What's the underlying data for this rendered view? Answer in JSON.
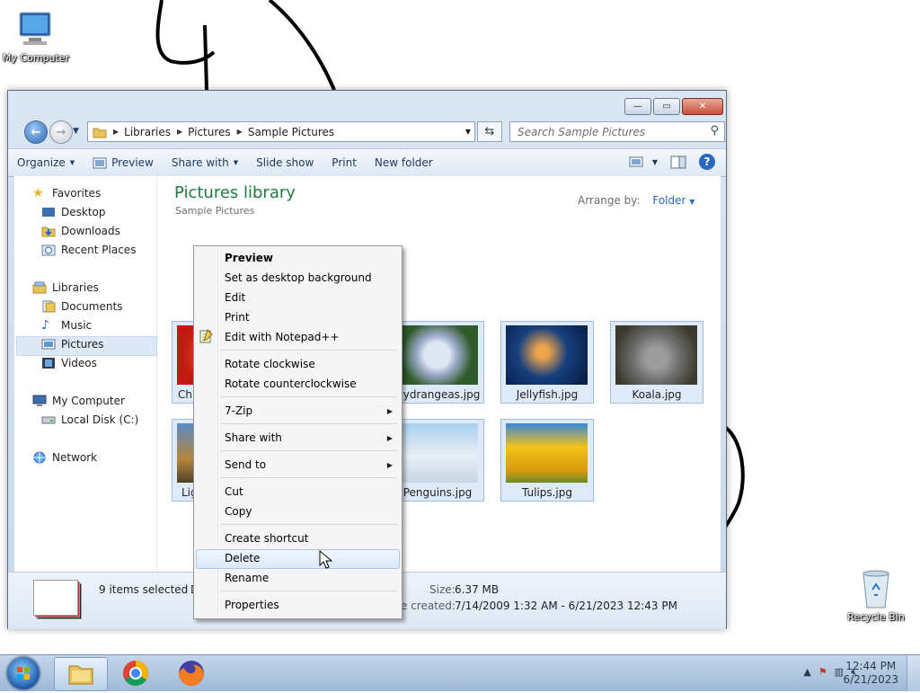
{
  "desktop": {
    "icons": [
      {
        "label": "My Computer",
        "icon": "my-computer-icon"
      },
      {
        "label": "Recycle Bin",
        "icon": "recycle-bin-icon"
      }
    ]
  },
  "window": {
    "address": {
      "segments": [
        "Libraries",
        "Pictures",
        "Sample Pictures"
      ]
    },
    "search_placeholder": "Search Sample Pictures",
    "toolbar": {
      "organize": "Organize",
      "preview": "Preview",
      "share_with": "Share with",
      "slide_show": "Slide show",
      "print": "Print",
      "new_folder": "New folder"
    },
    "nav_pane": {
      "favorites": "Favorites",
      "desktop": "Desktop",
      "downloads": "Downloads",
      "recent_places": "Recent Places",
      "libraries": "Libraries",
      "documents": "Documents",
      "music": "Music",
      "pictures": "Pictures",
      "videos": "Videos",
      "my_computer": "My Computer",
      "local_disk": "Local Disk (C:)",
      "network": "Network"
    },
    "library": {
      "title": "Pictures library",
      "subtitle": "Sample Pictures",
      "arrange_label": "Arrange by:",
      "arrange_value": "Folder"
    },
    "thumbnails": [
      {
        "caption": "Chr"
      },
      {
        "caption": ""
      },
      {
        "caption": "Hydrangeas.jpg"
      },
      {
        "caption": "Jellyfish.jpg"
      },
      {
        "caption": "Koala.jpg"
      },
      {
        "caption": "Lig"
      },
      {
        "caption": "Penguins.jpg"
      },
      {
        "caption": "Tulips.jpg"
      }
    ],
    "details": {
      "selected": "9 items selected",
      "selected_suffix": "D",
      "size_label": "Size:",
      "size_value": "6.37 MB",
      "date_label": "e created:",
      "date_value": "7/14/2009 1:32 AM - 6/21/2023 12:43 PM"
    }
  },
  "context_menu": {
    "items": {
      "preview": "Preview",
      "set_desktop_bg": "Set as desktop background",
      "edit": "Edit",
      "print": "Print",
      "edit_notepad": "Edit with Notepad++",
      "rotate_cw": "Rotate clockwise",
      "rotate_ccw": "Rotate counterclockwise",
      "seven_zip": "7-Zip",
      "share_with": "Share with",
      "send_to": "Send to",
      "cut": "Cut",
      "copy": "Copy",
      "create_shortcut": "Create shortcut",
      "delete": "Delete",
      "rename": "Rename",
      "properties": "Properties"
    },
    "highlighted": "Delete"
  },
  "taskbar": {
    "apps": [
      "windows-explorer",
      "google-chrome",
      "firefox"
    ],
    "time": "12:44 PM",
    "date": "6/21/2023"
  },
  "colors": {
    "library_title": "#1e7a3e",
    "link_blue": "#2a68c2",
    "selection": "#dde8f6"
  }
}
